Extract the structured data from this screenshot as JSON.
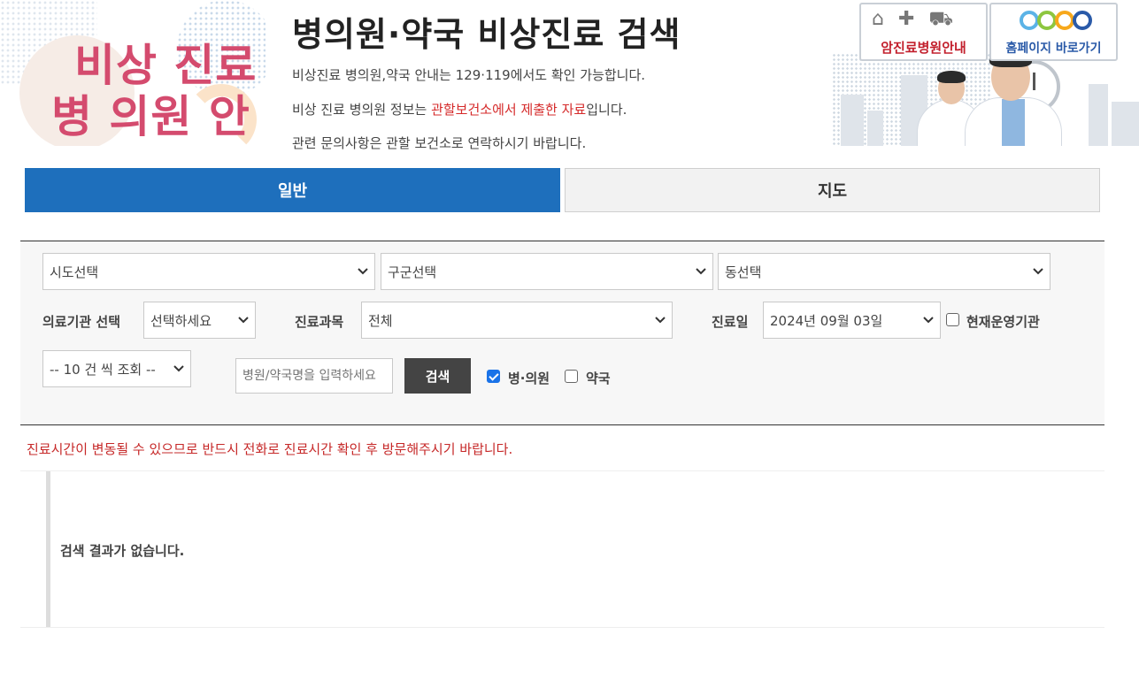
{
  "header": {
    "logo_line1": "비상 진료",
    "logo_line2": "병 의원 안내",
    "title": "병의원·약국 비상진료 검색",
    "info_line1": "비상진료 병의원,약국 안내는 129·119에서도 확인 가능합니다.",
    "info_line2_pre": "비상 진료 병의원 정보는 ",
    "info_line2_red": "관할보건소에서 제출한 자료",
    "info_line2_post": "입니다.",
    "info_line3": "관련 문의사항은 관할 보건소로 연락하시기 바랍니다."
  },
  "banner": {
    "cancer_label": "암진료병원안내",
    "home_label": "홈페이지 바로가기"
  },
  "tabs": [
    {
      "label": "일반",
      "active": true
    },
    {
      "label": "지도",
      "active": false
    }
  ],
  "filters": {
    "sido": "시도선택",
    "gugun": "구군선택",
    "dong": "동선택",
    "institution_label": "의료기관 선택",
    "institution_value": "선택하세요",
    "department_label": "진료과목",
    "department_value": "전체",
    "date_label": "진료일",
    "date_value": "2024년 09월 03일",
    "open_now_label": "현재운영기관",
    "open_now_checked": false,
    "page_size": "-- 10 건 씩 조회 --",
    "search_placeholder": "병원/약국명을 입력하세요",
    "search_button": "검색",
    "hospital_label": "병·의원",
    "hospital_checked": true,
    "pharmacy_label": "약국",
    "pharmacy_checked": false
  },
  "notice": "진료시간이 변동될 수 있으므로 반드시 전화로 진료시간 확인 후 방문해주시기 바랍니다.",
  "results": {
    "empty_message": "검색 결과가 없습니다."
  },
  "colors": {
    "tab_active": "#1e6fbc",
    "logo_pink": "#d44b6e",
    "notice_red": "#c62828"
  }
}
